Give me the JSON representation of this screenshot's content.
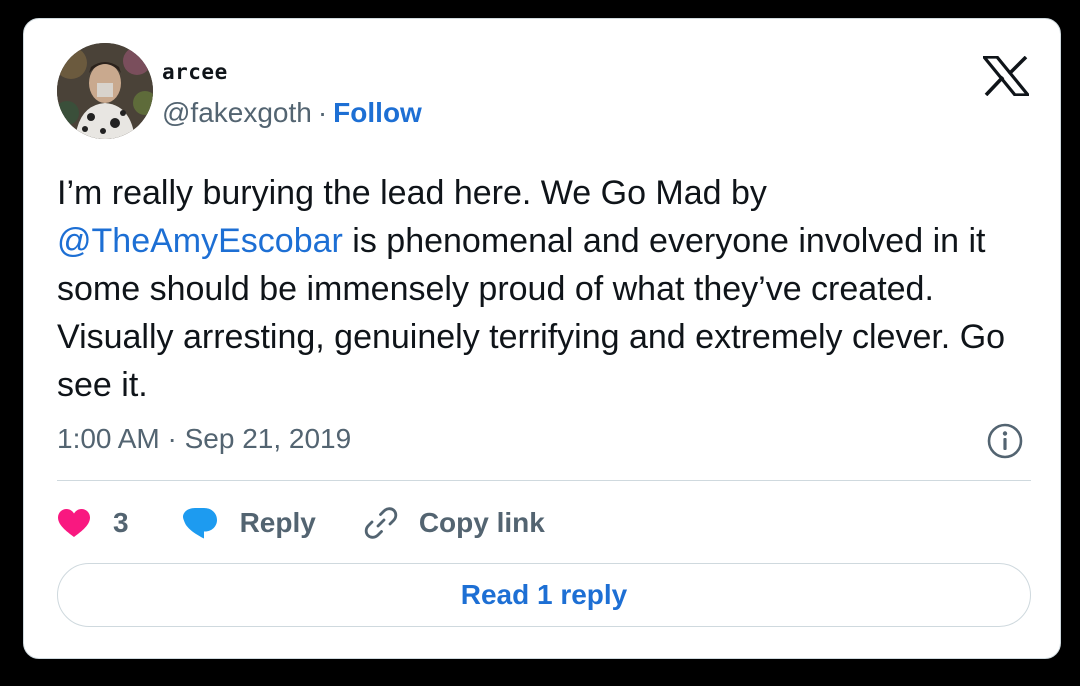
{
  "author": {
    "display_name": "arcee",
    "handle": "@fakexgoth",
    "separator": "·",
    "follow_label": "Follow",
    "avatar_icon": "profile-photo"
  },
  "brand": {
    "logo_icon": "x-logo-icon"
  },
  "tweet": {
    "text_part1": "I’m really burying the lead here. We Go Mad by ",
    "mention": "@TheAmyEscobar",
    "text_part2": " is phenomenal and everyone involved in it some should be immensely proud of what they’ve created. Visually arresting, genuinely terrifying and extremely clever. Go see it.",
    "timestamp": "1:00 AM · Sep 21, 2019"
  },
  "actions": {
    "like_count": "3",
    "reply_label": "Reply",
    "copy_link_label": "Copy link"
  },
  "read_reply_label": "Read 1 reply",
  "colors": {
    "accent": "#1d6fd4",
    "like": "#f91880",
    "reply_icon": "#1d9bf0",
    "muted": "#536471",
    "text": "#0f1419"
  }
}
